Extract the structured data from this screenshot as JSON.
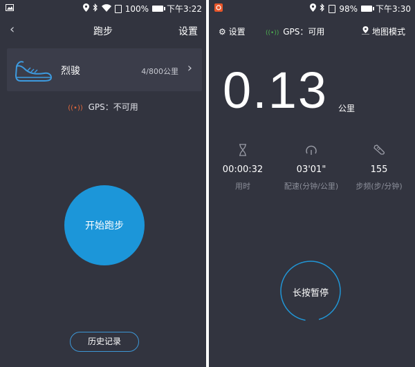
{
  "left_screen": {
    "status": {
      "battery": "100%",
      "time": "下午3:22"
    },
    "header": {
      "back": "‹",
      "title": "跑步",
      "settings": "设置"
    },
    "shoe": {
      "icon": "shoe-icon",
      "name": "烈骏",
      "distance": "4/800公里",
      "chevron": "›"
    },
    "gps": {
      "icon": "gps-signal-icon",
      "label": "GPS：不可用"
    },
    "start_button": "开始跑步",
    "history_button": "历史记录",
    "colors": {
      "background": "#32343f",
      "accent": "#1c96d9",
      "gps_off": "#e2683c"
    }
  },
  "right_screen": {
    "status": {
      "battery": "98%",
      "time": "下午3:30"
    },
    "header": {
      "settings": "设置",
      "gps": "GPS：可用",
      "map_mode": "地图模式"
    },
    "distance": {
      "value": "0.13",
      "unit": "公里"
    },
    "stats": [
      {
        "icon": "hourglass-icon",
        "value": "00:00:32",
        "label": "用时"
      },
      {
        "icon": "speedometer-icon",
        "value": "03'01\"",
        "label": "配速(分钟/公里)"
      },
      {
        "icon": "shoe-icon",
        "value": "155",
        "label": "步频(步/分钟)"
      }
    ],
    "pause_button": "长按暂停",
    "colors": {
      "gps_on": "#4caf50",
      "ring": "#2196d6"
    }
  }
}
